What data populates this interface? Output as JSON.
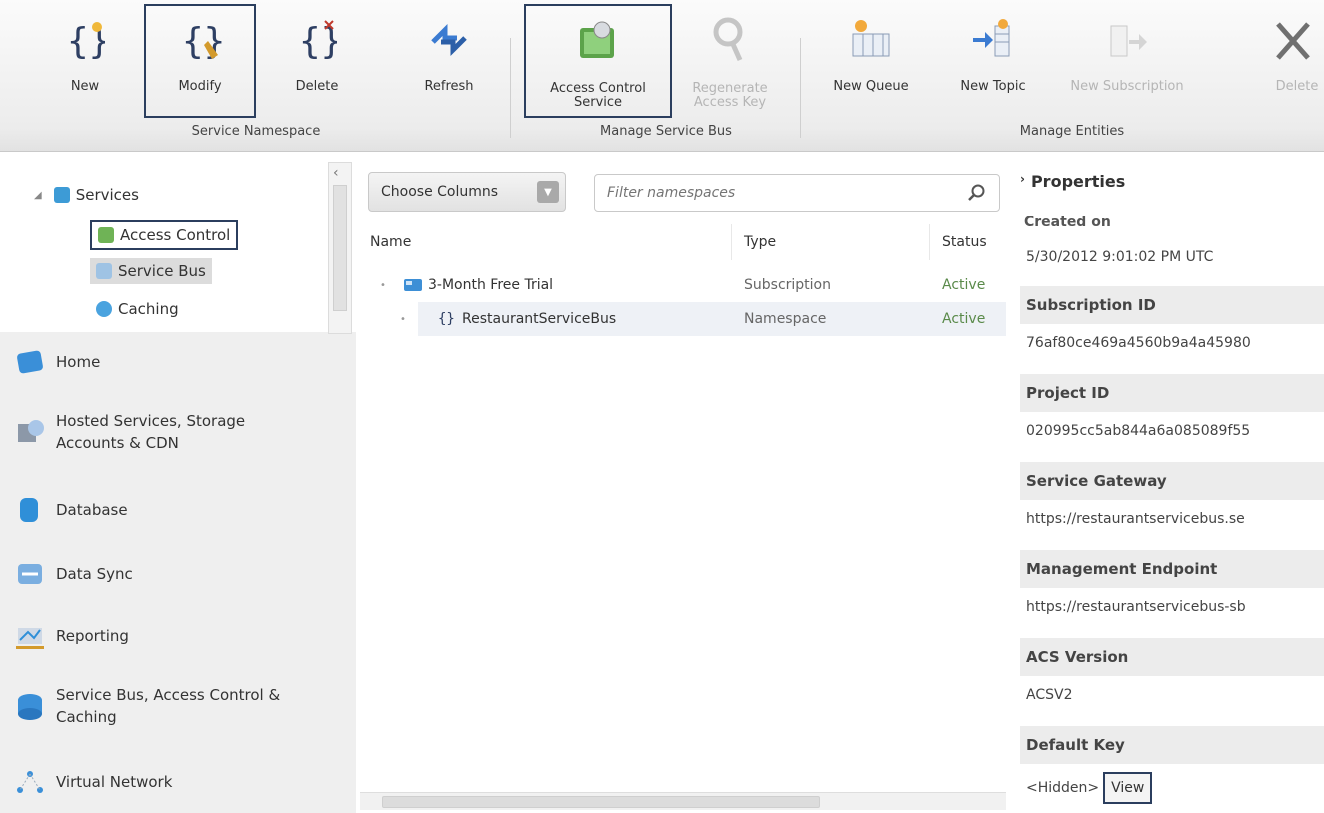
{
  "ribbon": {
    "buttons": [
      {
        "label": "New",
        "icon": "namespace-new-icon",
        "enabled": true
      },
      {
        "label": "Modify",
        "icon": "namespace-modify-icon",
        "enabled": true,
        "selected": true
      },
      {
        "label": "Delete",
        "icon": "namespace-delete-icon",
        "enabled": true
      },
      {
        "label": "Refresh",
        "icon": "refresh-icon",
        "enabled": true
      },
      {
        "label": "Access Control Service",
        "icon": "access-control-icon",
        "enabled": true,
        "selected": true
      },
      {
        "label": "Regenerate Access Key",
        "icon": "key-icon",
        "enabled": false
      },
      {
        "label": "New Queue",
        "icon": "queue-icon",
        "enabled": true
      },
      {
        "label": "New Topic",
        "icon": "topic-icon",
        "enabled": true
      },
      {
        "label": "New Subscription",
        "icon": "subscription-icon",
        "enabled": false
      },
      {
        "label": "Delete",
        "icon": "delete-x-icon",
        "enabled": false
      }
    ],
    "groups": [
      "Service Namespace",
      "Manage Service Bus",
      "Manage Entities"
    ]
  },
  "tree": {
    "root": "Services",
    "children": [
      "Access Control",
      "Service Bus",
      "Caching"
    ],
    "selected": "Service Bus",
    "highlighted": "Access Control"
  },
  "nav": [
    {
      "label": "Home",
      "icon": "home-icon"
    },
    {
      "label": "Hosted Services, Storage Accounts & CDN",
      "icon": "hosted-services-icon"
    },
    {
      "label": "Database",
      "icon": "database-icon"
    },
    {
      "label": "Data Sync",
      "icon": "data-sync-icon"
    },
    {
      "label": "Reporting",
      "icon": "reporting-icon"
    },
    {
      "label": "Service Bus, Access Control & Caching",
      "icon": "service-bus-icon"
    },
    {
      "label": "Virtual Network",
      "icon": "virtual-network-icon"
    }
  ],
  "toolbar": {
    "choose_columns": "Choose Columns",
    "filter_placeholder": "Filter namespaces"
  },
  "grid": {
    "columns": [
      "Name",
      "Type",
      "Status"
    ],
    "rows": [
      {
        "name": "3-Month Free Trial",
        "type": "Subscription",
        "status": "Active",
        "icon": "subscription-icon"
      },
      {
        "name": "RestaurantServiceBus",
        "type": "Namespace",
        "status": "Active",
        "icon": "namespace-icon",
        "selected": true
      }
    ]
  },
  "properties": {
    "header": "Properties",
    "cut_label": "Created on",
    "created_on": "5/30/2012 9:01:02 PM UTC",
    "items": [
      {
        "label": "Subscription ID",
        "value": "76af80ce469a4560b9a4a45980"
      },
      {
        "label": "Project ID",
        "value": "020995cc5ab844a6a085089f55"
      },
      {
        "label": "Service Gateway",
        "value": "https://restaurantservicebus.se"
      },
      {
        "label": "Management Endpoint",
        "value": "https://restaurantservicebus-sb"
      },
      {
        "label": "ACS Version",
        "value": "ACSV2"
      }
    ],
    "default_key": {
      "label": "Default Key",
      "value": "<Hidden>",
      "button": "View"
    }
  }
}
